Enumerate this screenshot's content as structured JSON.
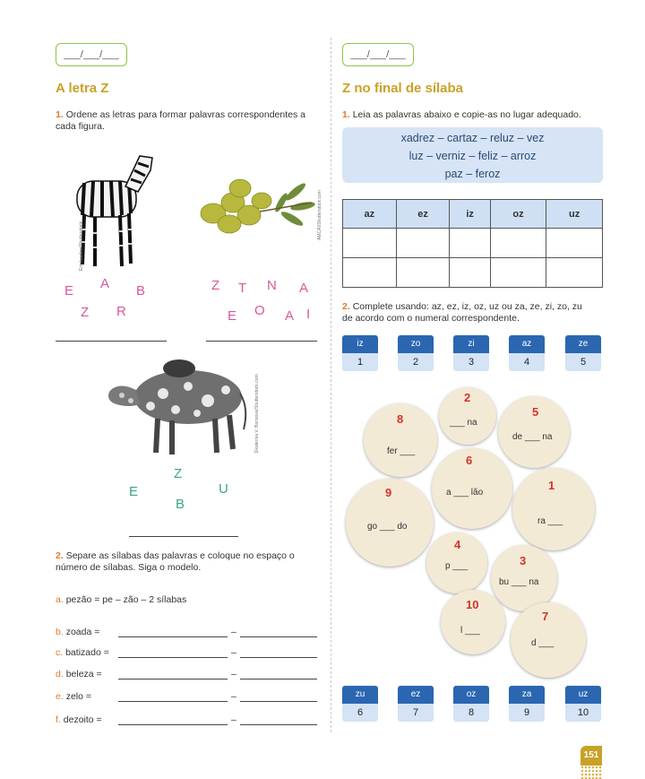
{
  "left": {
    "date_placeholder": "___/___/___",
    "title": "A letra Z",
    "ex1": {
      "number": "1.",
      "text": "Ordene as letras para formar palavras correspondentes a cada figura.",
      "zebra_letters": [
        "E",
        "A",
        "B",
        "Z",
        "R"
      ],
      "zebra_credit": "Eric Isselee/Shutterstock",
      "olive_letters": [
        "Z",
        "T",
        "N",
        "A",
        "E",
        "O",
        "A",
        "I"
      ],
      "olive_credit": "AMCAI/Shutterstock.com",
      "zebu_letters": [
        "Z",
        "E",
        "U",
        "B"
      ],
      "zebu_credit": "Ekaterina V. Borisova/Shutterstock.com"
    },
    "ex2": {
      "number": "2.",
      "text": "Separe as sílabas das palavras e coloque no espaço o número de sílabas. Siga o modelo.",
      "items": [
        {
          "letter": "a.",
          "text": "pezão = pe – zão – 2 sílabas"
        },
        {
          "letter": "b.",
          "text": "zoada ="
        },
        {
          "letter": "c.",
          "text": "batizado ="
        },
        {
          "letter": "d.",
          "text": "beleza ="
        },
        {
          "letter": "e.",
          "text": "zelo ="
        },
        {
          "letter": "f.",
          "text": "dezoito ="
        }
      ],
      "dash": "–"
    }
  },
  "right": {
    "date_placeholder": "___/___/___",
    "title": "Z no final de sílaba",
    "ex1": {
      "number": "1.",
      "text": "Leia as palavras abaixo e copie-as no lugar adequado.",
      "words_line1": "xadrez – cartaz – reluz – vez",
      "words_line2": "luz – verniz – feliz – arroz",
      "words_line3": "paz – feroz",
      "table_headers": [
        "az",
        "ez",
        "iz",
        "oz",
        "uz"
      ]
    },
    "ex2": {
      "number": "2.",
      "text_line1": "Complete usando: az, ez, iz, oz, uz ou za, ze, zi, zo, zu",
      "text_line2": "de acordo com o numeral correspondente.",
      "key_top": [
        {
          "syl": "iz",
          "num": "1"
        },
        {
          "syl": "zo",
          "num": "2"
        },
        {
          "syl": "zi",
          "num": "3"
        },
        {
          "syl": "az",
          "num": "4"
        },
        {
          "syl": "ze",
          "num": "5"
        }
      ],
      "key_bottom": [
        {
          "syl": "zu",
          "num": "6"
        },
        {
          "syl": "ez",
          "num": "7"
        },
        {
          "syl": "oz",
          "num": "8"
        },
        {
          "syl": "za",
          "num": "9"
        },
        {
          "syl": "uz",
          "num": "10"
        }
      ],
      "circles": [
        {
          "num": "8",
          "word": "fer ___"
        },
        {
          "num": "2",
          "word": "___ na"
        },
        {
          "num": "5",
          "word": "de ___ na"
        },
        {
          "num": "6",
          "word": "a ___ lão"
        },
        {
          "num": "9",
          "word": "go ___ do"
        },
        {
          "num": "1",
          "word": "ra ___"
        },
        {
          "num": "4",
          "word": "p ___"
        },
        {
          "num": "3",
          "word": "bu ___ na"
        },
        {
          "num": "10",
          "word": "l ___"
        },
        {
          "num": "7",
          "word": "d ___"
        }
      ]
    }
  },
  "page_number": "151",
  "colors": {
    "accent_title": "#c9a227",
    "key_blue": "#2b66b1",
    "circle_bg": "#f3ead6",
    "circle_num": "#d2342c"
  }
}
